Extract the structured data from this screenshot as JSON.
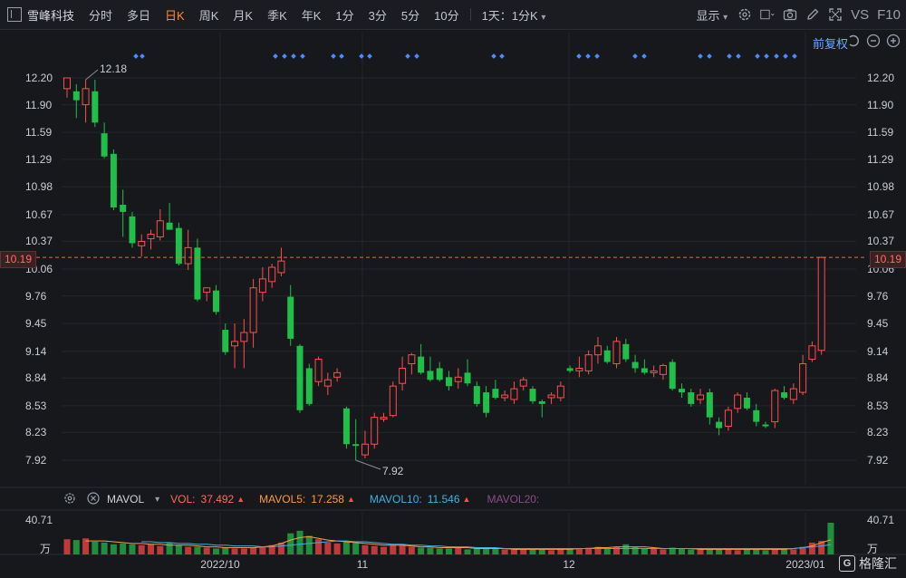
{
  "toolbar": {
    "stock_name": "雪峰科技",
    "periods": [
      "分时",
      "多日",
      "日K",
      "周K",
      "月K",
      "季K",
      "年K",
      "1分",
      "3分",
      "5分",
      "10分"
    ],
    "active_period": "日K",
    "period_dropdown": "1天：1分K",
    "display_label": "显示",
    "vs_label": "VS",
    "f10_label": "F10"
  },
  "fuquan_label": "前复权",
  "y_ticks": [
    "12.20",
    "11.90",
    "11.59",
    "11.29",
    "10.98",
    "10.67",
    "10.37",
    "10.06",
    "9.76",
    "9.45",
    "9.14",
    "8.84",
    "8.53",
    "8.23",
    "7.92"
  ],
  "current_price": "10.19",
  "high_annotation": "12.18",
  "low_annotation": "7.92",
  "volume_bar": {
    "indicator": "MAVOL",
    "vol_label": "VOL:",
    "vol_value": "37.492",
    "mavol5_label": "MAVOL5:",
    "mavol5_value": "17.258",
    "mavol10_label": "MAVOL10:",
    "mavol10_value": "11.546",
    "mavol20_label": "MAVOL20:",
    "vol_max": "40.71",
    "vol_unit": "万"
  },
  "x_labels": [
    "2022/10",
    "11",
    "12",
    "2023/01"
  ],
  "watermark": "格隆汇",
  "colors": {
    "up": "#ff4d4d",
    "down": "#1fbf4a",
    "accent": "#ff8a2b",
    "link": "#6fa8ff",
    "bg": "#17181c"
  },
  "chart_data": {
    "type": "candlestick",
    "ylim": [
      7.8,
      12.3
    ],
    "candles": [
      {
        "o": 12.08,
        "h": 12.18,
        "l": 11.98,
        "c": 12.2
      },
      {
        "o": 12.05,
        "h": 12.13,
        "l": 11.75,
        "c": 11.95
      },
      {
        "o": 11.9,
        "h": 12.18,
        "l": 11.7,
        "c": 12.08
      },
      {
        "o": 12.05,
        "h": 12.18,
        "l": 11.65,
        "c": 11.7
      },
      {
        "o": 11.58,
        "h": 11.7,
        "l": 11.3,
        "c": 11.32
      },
      {
        "o": 11.35,
        "h": 11.4,
        "l": 10.72,
        "c": 10.75
      },
      {
        "o": 10.78,
        "h": 10.95,
        "l": 10.42,
        "c": 10.7
      },
      {
        "o": 10.65,
        "h": 10.7,
        "l": 10.3,
        "c": 10.35
      },
      {
        "o": 10.32,
        "h": 10.45,
        "l": 10.2,
        "c": 10.37
      },
      {
        "o": 10.4,
        "h": 10.5,
        "l": 10.28,
        "c": 10.45
      },
      {
        "o": 10.42,
        "h": 10.73,
        "l": 10.38,
        "c": 10.6
      },
      {
        "o": 10.58,
        "h": 10.8,
        "l": 10.5,
        "c": 10.5
      },
      {
        "o": 10.52,
        "h": 10.58,
        "l": 10.1,
        "c": 10.12
      },
      {
        "o": 10.12,
        "h": 10.5,
        "l": 10.05,
        "c": 10.3
      },
      {
        "o": 10.3,
        "h": 10.4,
        "l": 9.7,
        "c": 9.72
      },
      {
        "o": 9.8,
        "h": 9.85,
        "l": 9.7,
        "c": 9.85
      },
      {
        "o": 9.82,
        "h": 9.88,
        "l": 9.55,
        "c": 9.58
      },
      {
        "o": 9.38,
        "h": 9.45,
        "l": 9.1,
        "c": 9.13
      },
      {
        "o": 9.2,
        "h": 9.45,
        "l": 8.95,
        "c": 9.25
      },
      {
        "o": 9.25,
        "h": 9.5,
        "l": 8.95,
        "c": 9.35
      },
      {
        "o": 9.35,
        "h": 9.95,
        "l": 9.18,
        "c": 9.85
      },
      {
        "o": 9.8,
        "h": 10.08,
        "l": 9.7,
        "c": 9.95
      },
      {
        "o": 9.92,
        "h": 10.12,
        "l": 9.85,
        "c": 10.08
      },
      {
        "o": 10.02,
        "h": 10.3,
        "l": 9.98,
        "c": 10.15
      },
      {
        "o": 9.75,
        "h": 9.88,
        "l": 9.2,
        "c": 9.28
      },
      {
        "o": 9.2,
        "h": 9.22,
        "l": 8.45,
        "c": 8.48
      },
      {
        "o": 8.95,
        "h": 9.0,
        "l": 8.53,
        "c": 8.55
      },
      {
        "o": 8.8,
        "h": 9.08,
        "l": 8.75,
        "c": 9.05
      },
      {
        "o": 8.75,
        "h": 8.9,
        "l": 8.65,
        "c": 8.82
      },
      {
        "o": 8.85,
        "h": 8.95,
        "l": 8.8,
        "c": 8.9
      },
      {
        "o": 8.5,
        "h": 8.52,
        "l": 8.05,
        "c": 8.1
      },
      {
        "o": 8.1,
        "h": 8.38,
        "l": 7.92,
        "c": 8.08
      },
      {
        "o": 7.98,
        "h": 8.25,
        "l": 7.94,
        "c": 8.1
      },
      {
        "o": 8.1,
        "h": 8.45,
        "l": 8.05,
        "c": 8.4
      },
      {
        "o": 8.38,
        "h": 8.45,
        "l": 8.35,
        "c": 8.4
      },
      {
        "o": 8.42,
        "h": 8.8,
        "l": 8.4,
        "c": 8.75
      },
      {
        "o": 8.78,
        "h": 9.08,
        "l": 8.7,
        "c": 8.95
      },
      {
        "o": 9.0,
        "h": 9.12,
        "l": 8.88,
        "c": 9.1
      },
      {
        "o": 9.08,
        "h": 9.22,
        "l": 8.88,
        "c": 8.9
      },
      {
        "o": 8.92,
        "h": 9.08,
        "l": 8.8,
        "c": 8.82
      },
      {
        "o": 8.95,
        "h": 9.02,
        "l": 8.8,
        "c": 8.82
      },
      {
        "o": 8.85,
        "h": 8.92,
        "l": 8.7,
        "c": 8.75
      },
      {
        "o": 8.8,
        "h": 8.95,
        "l": 8.72,
        "c": 8.85
      },
      {
        "o": 8.9,
        "h": 9.05,
        "l": 8.75,
        "c": 8.78
      },
      {
        "o": 8.75,
        "h": 8.8,
        "l": 8.52,
        "c": 8.55
      },
      {
        "o": 8.68,
        "h": 8.75,
        "l": 8.4,
        "c": 8.45
      },
      {
        "o": 8.72,
        "h": 8.82,
        "l": 8.6,
        "c": 8.62
      },
      {
        "o": 8.62,
        "h": 8.7,
        "l": 8.58,
        "c": 8.65
      },
      {
        "o": 8.6,
        "h": 8.8,
        "l": 8.55,
        "c": 8.72
      },
      {
        "o": 8.75,
        "h": 8.85,
        "l": 8.7,
        "c": 8.82
      },
      {
        "o": 8.72,
        "h": 8.75,
        "l": 8.55,
        "c": 8.58
      },
      {
        "o": 8.58,
        "h": 8.6,
        "l": 8.4,
        "c": 8.55
      },
      {
        "o": 8.62,
        "h": 8.68,
        "l": 8.55,
        "c": 8.65
      },
      {
        "o": 8.62,
        "h": 8.8,
        "l": 8.58,
        "c": 8.75
      },
      {
        "o": 8.95,
        "h": 8.98,
        "l": 8.9,
        "c": 8.92
      },
      {
        "o": 8.92,
        "h": 9.08,
        "l": 8.85,
        "c": 8.95
      },
      {
        "o": 8.92,
        "h": 9.15,
        "l": 8.88,
        "c": 9.1
      },
      {
        "o": 9.1,
        "h": 9.3,
        "l": 9.0,
        "c": 9.2
      },
      {
        "o": 9.15,
        "h": 9.2,
        "l": 9.0,
        "c": 9.02
      },
      {
        "o": 9.0,
        "h": 9.3,
        "l": 8.95,
        "c": 9.25
      },
      {
        "o": 9.22,
        "h": 9.28,
        "l": 9.02,
        "c": 9.05
      },
      {
        "o": 9.02,
        "h": 9.1,
        "l": 8.9,
        "c": 8.95
      },
      {
        "o": 8.95,
        "h": 9.05,
        "l": 8.88,
        "c": 8.9
      },
      {
        "o": 8.9,
        "h": 8.98,
        "l": 8.85,
        "c": 8.92
      },
      {
        "o": 8.88,
        "h": 9.0,
        "l": 8.82,
        "c": 8.98
      },
      {
        "o": 9.02,
        "h": 9.05,
        "l": 8.7,
        "c": 8.72
      },
      {
        "o": 8.72,
        "h": 8.78,
        "l": 8.62,
        "c": 8.68
      },
      {
        "o": 8.68,
        "h": 8.72,
        "l": 8.52,
        "c": 8.55
      },
      {
        "o": 8.6,
        "h": 8.72,
        "l": 8.55,
        "c": 8.65
      },
      {
        "o": 8.68,
        "h": 8.72,
        "l": 8.32,
        "c": 8.4
      },
      {
        "o": 8.35,
        "h": 8.4,
        "l": 8.2,
        "c": 8.28
      },
      {
        "o": 8.3,
        "h": 8.52,
        "l": 8.25,
        "c": 8.48
      },
      {
        "o": 8.5,
        "h": 8.68,
        "l": 8.45,
        "c": 8.65
      },
      {
        "o": 8.62,
        "h": 8.68,
        "l": 8.48,
        "c": 8.5
      },
      {
        "o": 8.48,
        "h": 8.55,
        "l": 8.3,
        "c": 8.35
      },
      {
        "o": 8.32,
        "h": 8.35,
        "l": 8.28,
        "c": 8.3
      },
      {
        "o": 8.35,
        "h": 8.72,
        "l": 8.28,
        "c": 8.7
      },
      {
        "o": 8.68,
        "h": 8.75,
        "l": 8.6,
        "c": 8.62
      },
      {
        "o": 8.6,
        "h": 8.78,
        "l": 8.55,
        "c": 8.72
      },
      {
        "o": 8.68,
        "h": 9.1,
        "l": 8.65,
        "c": 9.0
      },
      {
        "o": 9.05,
        "h": 9.25,
        "l": 9.02,
        "c": 9.2
      },
      {
        "o": 9.15,
        "h": 10.2,
        "l": 9.1,
        "c": 10.19
      }
    ],
    "volume_max": 40.71,
    "volumes": [
      18,
      17,
      19,
      15,
      14,
      12,
      13,
      12,
      11,
      12,
      10,
      14,
      11,
      9,
      9,
      8,
      7,
      8,
      7,
      7,
      8,
      9,
      11,
      14,
      25,
      28,
      22,
      18,
      14,
      13,
      16,
      14,
      11,
      10,
      9,
      11,
      12,
      9,
      8,
      8,
      7,
      7,
      8,
      6,
      8,
      8,
      7,
      6,
      6,
      7,
      6,
      6,
      5,
      6,
      6,
      7,
      8,
      9,
      8,
      9,
      12,
      9,
      7,
      8,
      6,
      8,
      7,
      6,
      6,
      6,
      7,
      6,
      5,
      6,
      6,
      5,
      6,
      7,
      6,
      9,
      14,
      16,
      37.492
    ],
    "mavol5": [
      16,
      16,
      16,
      15,
      14,
      13,
      13,
      12,
      12,
      11,
      11,
      11,
      10,
      9,
      9,
      8,
      8,
      8,
      8,
      9,
      10,
      13,
      17,
      20,
      21,
      19,
      17,
      16,
      15,
      14,
      13,
      12,
      11,
      11,
      11,
      10,
      9,
      9,
      8,
      8,
      8,
      8,
      7,
      7,
      7,
      7,
      6,
      6,
      6,
      6,
      6,
      6,
      6,
      7,
      7,
      8,
      8,
      9,
      9,
      9,
      9,
      8,
      7,
      7,
      7,
      7,
      6,
      6,
      6,
      6,
      6,
      6,
      6,
      6,
      6,
      6,
      7,
      8,
      10,
      14,
      17.258
    ],
    "mavol10": [
      15,
      15,
      14,
      14,
      13,
      13,
      12,
      12,
      11,
      11,
      10,
      10,
      10,
      9,
      9,
      10,
      11,
      12,
      13,
      14,
      15,
      16,
      16,
      15,
      15,
      14,
      13,
      12,
      12,
      11,
      11,
      10,
      10,
      9,
      9,
      9,
      8,
      8,
      8,
      7,
      7,
      7,
      7,
      7,
      7,
      7,
      7,
      7,
      7,
      7,
      7,
      7,
      7,
      7,
      7,
      7,
      7,
      7,
      7,
      7,
      7,
      7,
      7,
      7,
      7,
      7,
      7,
      7,
      7,
      7,
      7,
      8,
      9,
      10,
      11.546
    ]
  }
}
